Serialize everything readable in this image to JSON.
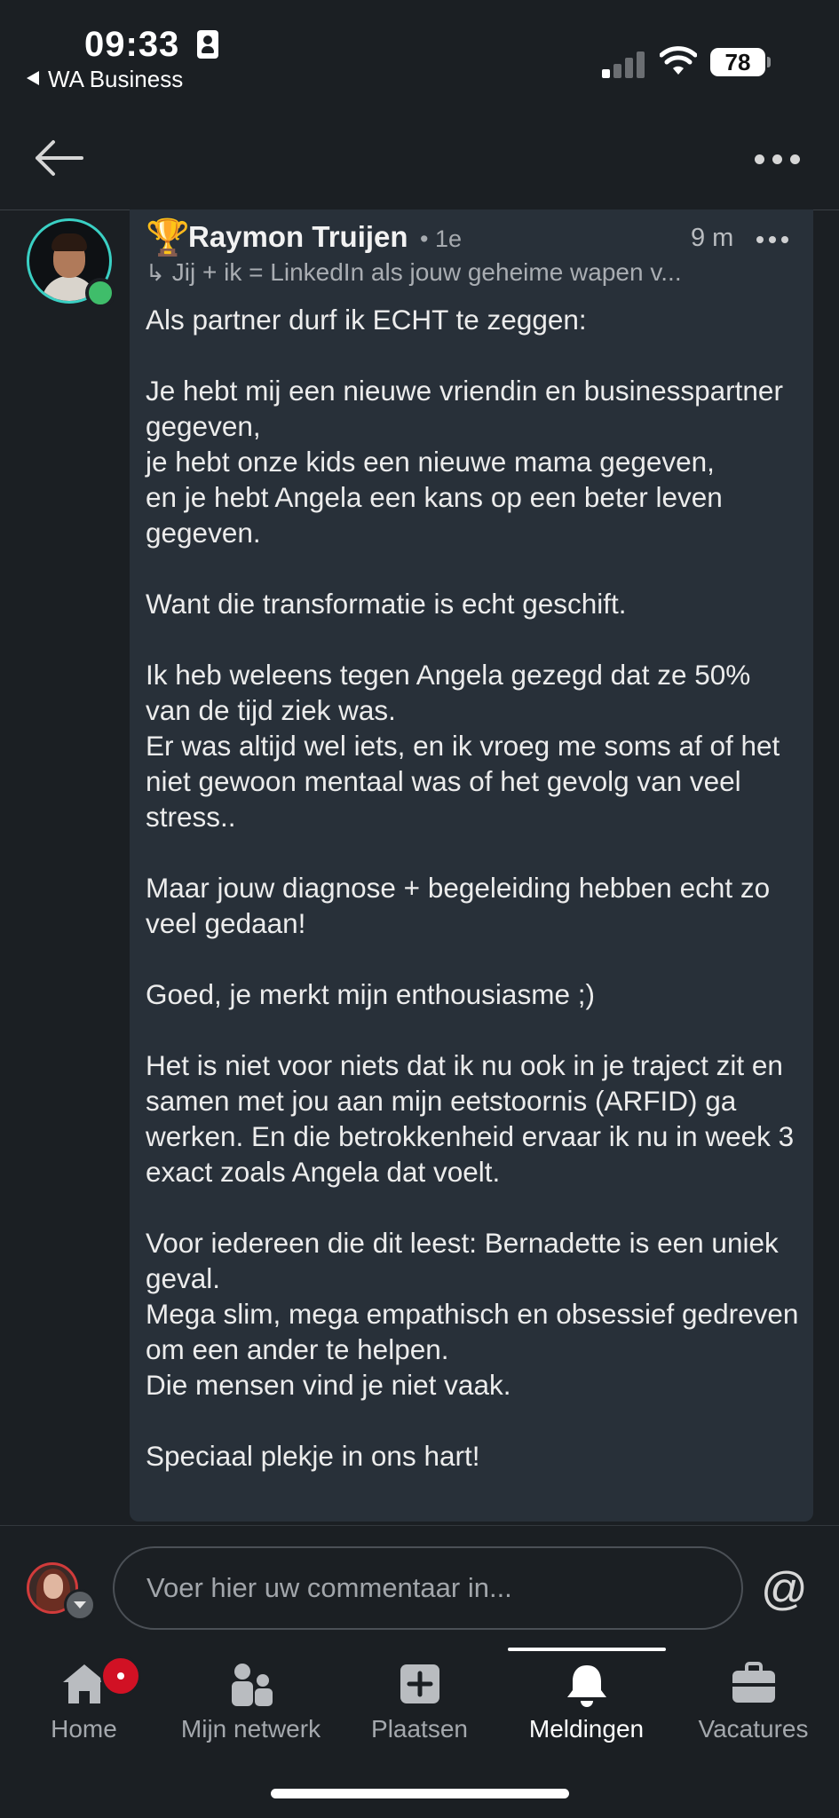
{
  "status_bar": {
    "time": "09:33",
    "back_app": "WA Business",
    "battery": "78"
  },
  "comment": {
    "author": "Raymon Truijen",
    "degree": "• 1e",
    "time_ago": "9 m",
    "reply_to": "Jij + ik = LinkedIn als jouw geheime wapen v...",
    "paragraphs": [
      "Als partner durf ik ECHT te zeggen:",
      "Je hebt mij een nieuwe vriendin en businesspartner gegeven,\nje hebt onze kids een nieuwe mama gegeven,\nen je hebt Angela een kans op een beter leven gegeven.",
      "Want die transformatie is echt geschift.",
      "Ik heb weleens tegen Angela gezegd dat ze 50% van de tijd ziek was.\nEr was altijd wel iets, en ik vroeg me soms af of het niet gewoon mentaal was of het gevolg van veel stress..",
      "Maar jouw diagnose + begeleiding hebben echt zo veel gedaan!",
      "Goed, je merkt mijn enthousiasme ;)",
      "Het is niet voor niets dat ik nu ook in je traject zit en samen met jou aan mijn eetstoornis (ARFID) ga werken. En die betrokkenheid ervaar ik nu in week 3 exact zoals Angela dat voelt.",
      "Voor iedereen die dit leest: Bernadette is een uniek geval.\nMega slim, mega empathisch en obsessief gedreven om een ander te helpen.\nDie mensen vind je niet vaak.",
      "Speciaal plekje in ons hart!"
    ]
  },
  "composer": {
    "placeholder": "Voer hier uw commentaar in...",
    "mention_symbol": "@"
  },
  "tabs": [
    {
      "label": "Home",
      "icon": "home-icon"
    },
    {
      "label": "Mijn netwerk",
      "icon": "network-icon"
    },
    {
      "label": "Plaatsen",
      "icon": "post-icon"
    },
    {
      "label": "Meldingen",
      "icon": "bell-icon",
      "active": true
    },
    {
      "label": "Vacatures",
      "icon": "briefcase-icon"
    }
  ],
  "colors": {
    "background": "#1b1f23",
    "bubble": "#283039",
    "online": "#3fbd6a",
    "badge": "#d11124",
    "avatar_ring": "#3ad0c4"
  }
}
